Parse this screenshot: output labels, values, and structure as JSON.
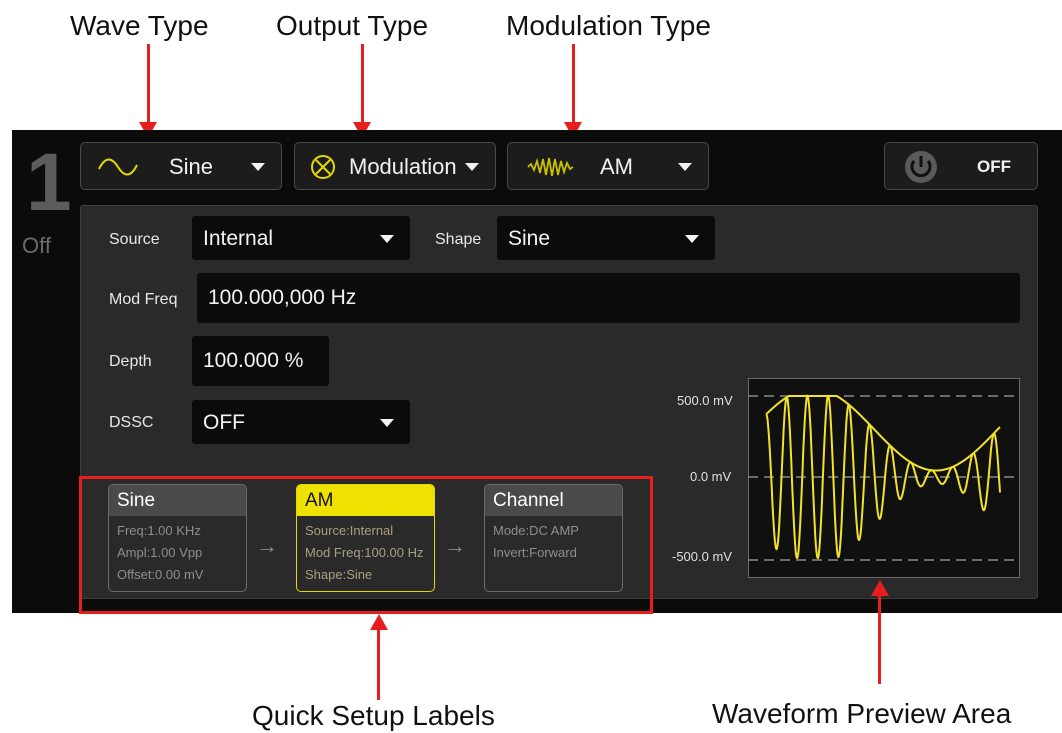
{
  "callouts": {
    "wave_type": "Wave Type",
    "output_type": "Output Type",
    "modulation_type": "Modulation Type",
    "quick_setup": "Quick Setup Labels",
    "waveform_preview": "Waveform Preview Area"
  },
  "channel": {
    "number": "1",
    "state": "Off"
  },
  "toolbar": {
    "wave_type": "Sine",
    "output_type": "Modulation",
    "modulation_type": "AM",
    "power_label": "OFF"
  },
  "settings": {
    "source_label": "Source",
    "source_value": "Internal",
    "shape_label": "Shape",
    "shape_value": "Sine",
    "mod_freq_label": "Mod Freq",
    "mod_freq_value": "100.000,000 Hz",
    "depth_label": "Depth",
    "depth_value": "100.000 %",
    "dssc_label": "DSSC",
    "dssc_value": "OFF"
  },
  "quick_setup": [
    {
      "title": "Sine",
      "lines": [
        "Freq:1.00 KHz",
        "Ampl:1.00 Vpp",
        "Offset:0.00 mV"
      ]
    },
    {
      "title": "AM",
      "lines": [
        "Source:Internal",
        "Mod Freq:100.00 Hz",
        "Shape:Sine"
      ]
    },
    {
      "title": "Channel",
      "lines": [
        "Mode:DC AMP",
        "Invert:Forward"
      ]
    }
  ],
  "preview": {
    "y_labels": [
      "500.0 mV",
      "0.0 mV",
      "-500.0 mV"
    ],
    "trace_color": "#f2e22a"
  },
  "colors": {
    "accent_yellow": "#efe200",
    "callout_red": "#e61e1e"
  }
}
